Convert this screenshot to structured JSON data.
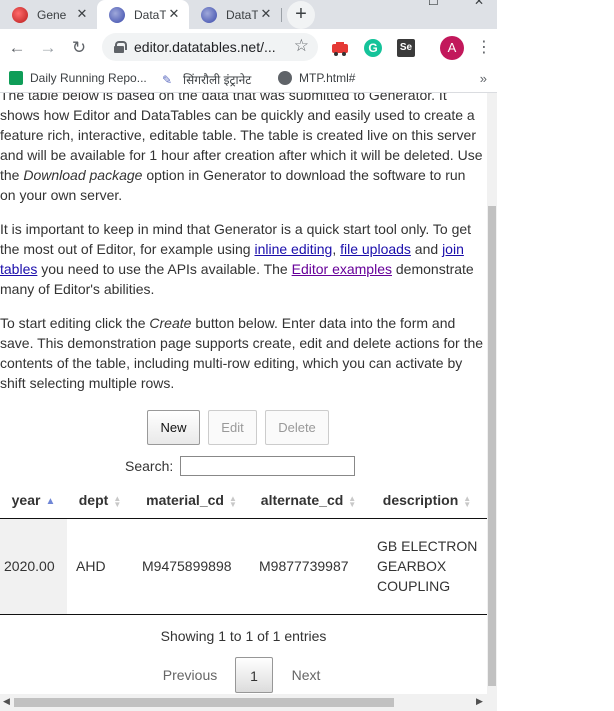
{
  "browser": {
    "tabs": [
      {
        "label": "Gene",
        "active": false
      },
      {
        "label": "DataT",
        "active": true
      },
      {
        "label": "DataT",
        "active": false
      }
    ],
    "new_tab_symbol": "+",
    "close_symbol": "✕",
    "url": "editor.datatables.net/...",
    "profile_initial": "A",
    "bookmarks": [
      {
        "label": "Daily Running Repo..."
      },
      {
        "label": "सिंगरौली इंट्रानेट"
      },
      {
        "label": "MTP.html#"
      }
    ],
    "bookmarks_more": "»"
  },
  "page": {
    "para1_pre": "The table below is based on the data that was submitted to Generator. It shows how Editor and DataTables can be quickly and easily used to create a feature rich, interactive, editable table. The table is created live on this server and will be available for 1 hour after creation after which it will be deleted. Use the ",
    "para1_em": "Download package",
    "para1_post": " option in Generator to download the software to run on your own server.",
    "para2_pre": "It is important to keep in mind that Generator is a quick start tool only. To get the most out of Editor, for example using ",
    "link_inline": "inline editing",
    "sep1": ", ",
    "link_upload": "file uploads",
    "sep2": " and ",
    "link_join": "join tables",
    "para2_mid": " you need to use the APIs available. The ",
    "link_examples": "Editor examples",
    "para2_post": " demonstrate many of Editor's abilities.",
    "para3_pre": "To start editing click the ",
    "para3_em": "Create",
    "para3_post": " button below. Enter data into the form and save. This demonstration page supports create, edit and delete actions for the contents of the table, including multi-row editing, which you can activate by shift selecting multiple rows."
  },
  "buttons": {
    "new": "New",
    "edit": "Edit",
    "delete": "Delete"
  },
  "search": {
    "label": "Search:",
    "value": ""
  },
  "table": {
    "columns": [
      "year",
      "dept",
      "material_cd",
      "alternate_cd",
      "description"
    ],
    "rows": [
      {
        "year": "2020.00",
        "dept": "AHD",
        "material_cd": "M9475899898",
        "alternate_cd": "M9877739987",
        "description": "GB ELECTRON GEARBOX COUPLING"
      }
    ]
  },
  "info": "Showing 1 to 1 of 1 entries",
  "paging": {
    "previous": "Previous",
    "current": "1",
    "next": "Next"
  },
  "colors": {
    "link": "#1a0dab",
    "visited_link": "#660099",
    "sort_active": "#6f86d6",
    "profile": "#c2185b"
  }
}
